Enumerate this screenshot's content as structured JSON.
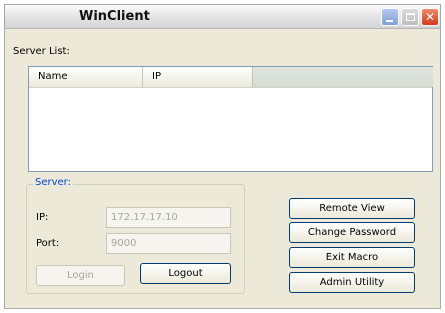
{
  "window": {
    "title": "WinClient"
  },
  "server_list": {
    "label": "Server List:",
    "columns": [
      "Name",
      "IP"
    ],
    "rows": []
  },
  "server_group": {
    "title": "Server:",
    "ip_label": "IP:",
    "ip_value": "172.17.17.10",
    "port_label": "Port:",
    "port_value": "9000",
    "login_label": "Login",
    "logout_label": "Logout"
  },
  "actions": {
    "remote_view": "Remote View",
    "change_password": "Change Password",
    "exit_macro": "Exit Macro",
    "admin_utility": "Admin Utility"
  }
}
